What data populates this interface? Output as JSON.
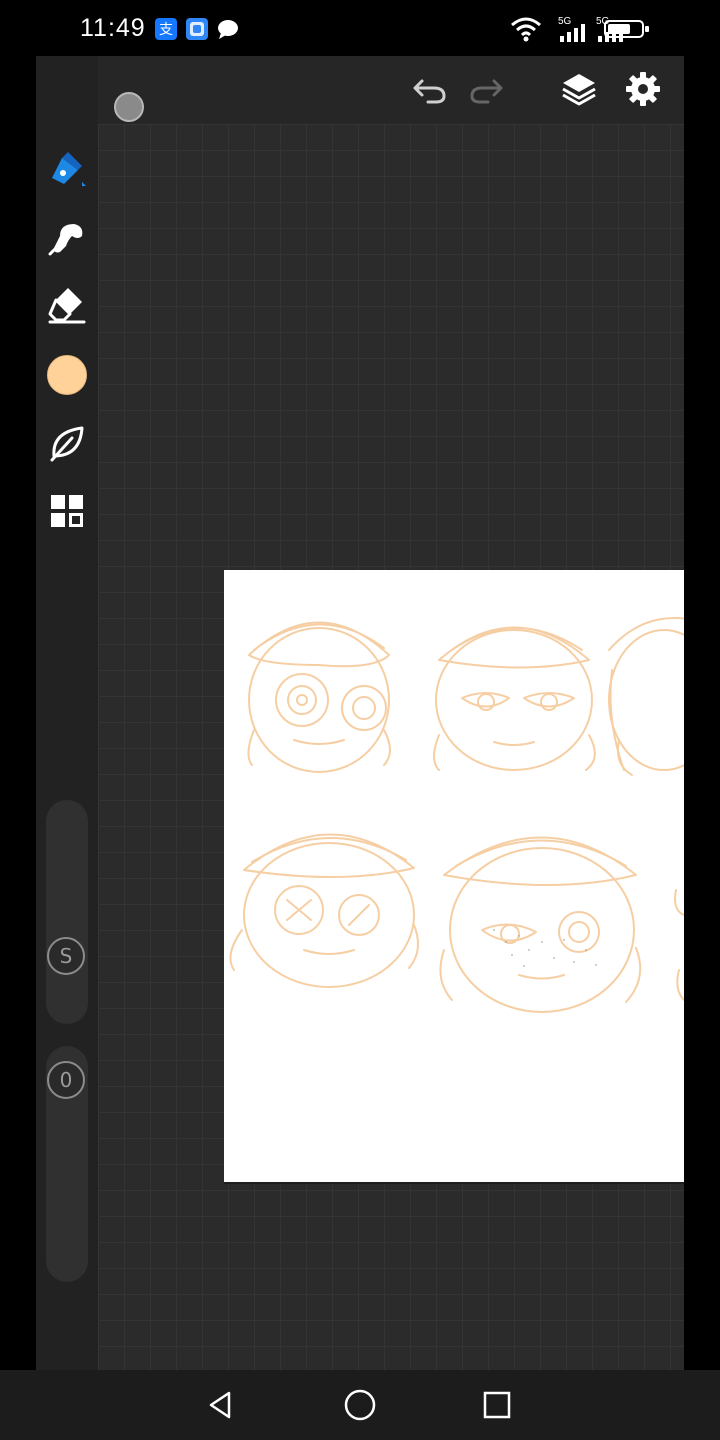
{
  "status_bar": {
    "time": "11:49",
    "signal_1_label": "5G",
    "signal_2_label": "5G",
    "icons": [
      "alipay-icon",
      "browser-icon",
      "chat-icon",
      "wifi-icon",
      "signal-icon",
      "signal-icon",
      "battery-icon"
    ]
  },
  "topbar": {
    "icons": [
      "close-icon",
      "brush-preview",
      "undo-icon",
      "redo-icon",
      "layers-icon",
      "gear-icon"
    ]
  },
  "toolbar": {
    "tools": [
      "pen-icon",
      "smudge-icon",
      "eraser-icon",
      "color-swatch",
      "leaf-icon",
      "grid-icon"
    ],
    "current_color": "#ffd29a",
    "size_knob_label": "S",
    "opacity_knob_label": "0"
  },
  "canvas": {
    "paper_color": "#ffffff",
    "sketch_color": "#f6c99a",
    "grid_color": "#343434",
    "background_color": "#2b2b2b"
  },
  "navbar": {
    "icons": [
      "back-icon",
      "home-icon",
      "recents-icon"
    ]
  }
}
